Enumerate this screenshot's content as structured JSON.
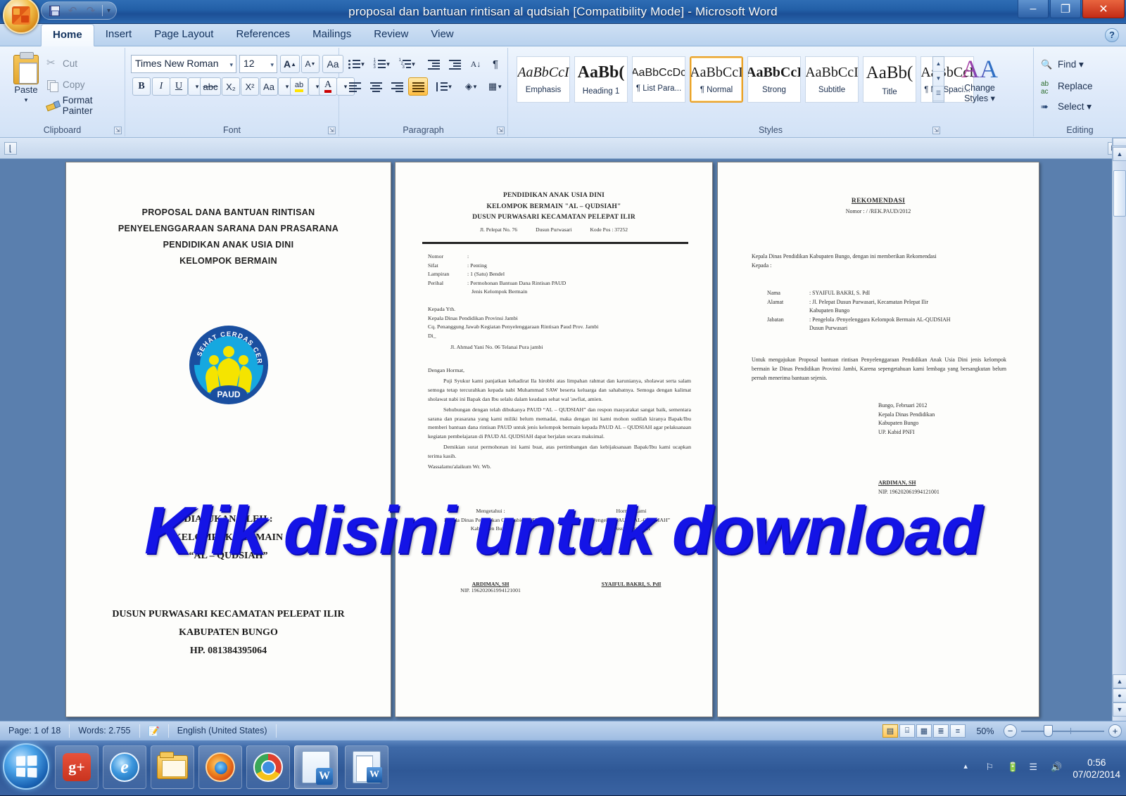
{
  "window": {
    "title": "proposal dan bantuan rintisan al qudsiah [Compatibility Mode] - Microsoft Word",
    "minimize": "–",
    "maximize": "❐",
    "close": "✕"
  },
  "quick_access": {
    "save": "save-icon",
    "undo": "↶",
    "redo": "↷",
    "customize": "▾"
  },
  "tabs": [
    {
      "label": "Home",
      "active": true
    },
    {
      "label": "Insert",
      "active": false
    },
    {
      "label": "Page Layout",
      "active": false
    },
    {
      "label": "References",
      "active": false
    },
    {
      "label": "Mailings",
      "active": false
    },
    {
      "label": "Review",
      "active": false
    },
    {
      "label": "View",
      "active": false
    }
  ],
  "help_button": "?",
  "ribbon": {
    "clipboard": {
      "label": "Clipboard",
      "paste": "Paste",
      "paste_caret": "▾",
      "cut": "Cut",
      "copy": "Copy",
      "format_painter": "Format Painter"
    },
    "font": {
      "label": "Font",
      "font_family_value": "Times New Roman",
      "font_size_value": "12",
      "grow_font": "A",
      "shrink_font": "A",
      "clear_formatting": "Aa",
      "bold": "B",
      "italic": "I",
      "underline": "U",
      "strikethrough": "abc",
      "subscript": "X₂",
      "superscript": "X²",
      "change_case": "Aa",
      "highlight": "ab",
      "font_color": "A",
      "caret": "▾"
    },
    "paragraph": {
      "label": "Paragraph",
      "bullets": "bullet-list-icon",
      "numbering": "numbered-list-icon",
      "multilevel": "multilevel-list-icon",
      "decrease_indent": "decrease-indent-icon",
      "increase_indent": "increase-indent-icon",
      "sort": "sort-icon",
      "show_marks": "¶",
      "align_left": "align-left-icon",
      "align_center": "align-center-icon",
      "align_right": "align-right-icon",
      "justify": "justify-icon",
      "line_spacing": "line-spacing-icon",
      "shading": "shading-icon",
      "borders": "borders-icon"
    },
    "styles": {
      "label": "Styles",
      "items": [
        {
          "preview": "AaBbCcI",
          "name": "Emphasis",
          "selected": false
        },
        {
          "preview": "AaBb(",
          "name": "Heading 1",
          "selected": false
        },
        {
          "preview": "AaBbCcDc",
          "name": "¶ List Para...",
          "selected": false
        },
        {
          "preview": "AaBbCcI",
          "name": "¶ Normal",
          "selected": true
        },
        {
          "preview": "AaBbCcI",
          "name": "Strong",
          "selected": false
        },
        {
          "preview": "AaBbCcI",
          "name": "Subtitle",
          "selected": false
        },
        {
          "preview": "AaBb(",
          "name": "Title",
          "selected": false
        },
        {
          "preview": "AaBbCcI",
          "name": "¶ No Spaci...",
          "selected": false
        }
      ],
      "change_styles_line1": "Change",
      "change_styles_line2": "Styles ▾"
    },
    "editing": {
      "label": "Editing",
      "find": "Find ▾",
      "replace": "Replace",
      "select": "Select ▾"
    }
  },
  "document": {
    "page1": {
      "title_lines": [
        "PROPOSAL DANA BANTUAN RINTISAN",
        "PENYELENGGARAAN  SARANA  DAN  PRASARANA",
        "PENDIDIKAN ANAK USIA DINI",
        "KELOMPOK BERMAIN"
      ],
      "logo": {
        "arc_text": "SEHAT CERDAS CERIA",
        "badge_text": "PAUD"
      },
      "submitted_by": [
        "DIAJUKAN OLEH :",
        "KELOMPOK BERMAIN",
        "“AL – QUDSIAH”"
      ],
      "footer_lines": [
        "DUSUN PURWASARI KECAMATAN PELEPAT ILIR",
        "KABUPATEN BUNGO",
        "HP. 081384395064"
      ]
    },
    "page2": {
      "letterhead": [
        "PENDIDIKAN ANAK USIA DINI",
        "KELOMPOK BERMAIN \"AL – QUDSIAH\"",
        "DUSUN PURWASARI KECAMATAN PELEPAT ILIR"
      ],
      "address": [
        "Jl. Pelepat No. 76",
        "Dusun Purwasari",
        "Kode Pos : 37252"
      ],
      "meta": [
        {
          "key": "Nomor",
          "value": ":"
        },
        {
          "key": "Sifat",
          "value": ": Penting"
        },
        {
          "key": "Lampiran",
          "value": ": 1 (Satu) Bendel"
        },
        {
          "key": "Perihal",
          "value": ": Permohonan Bantuan Dana Rintisan PAUD"
        }
      ],
      "meta_cont": "Jenis Kelompok Bermain",
      "addressee": [
        "Kepada Yth.",
        "Kepala Dinas Pendidikan Provinsi Jambi",
        "Cq. Penanggung Jawab Kegiatan Penyelenggaraan Rintisan Paud Prov. Jambi",
        "Di_"
      ],
      "addressee_indent": "Jl. Ahmad Yani No. 06 Telanai Pura jambi",
      "body": [
        "Dengan Hormat,",
        "Puji Syukur kami panjatkan kehadirat Ila hirobbi atas limpahan rahmat dan karunianya, sholawat serta salam semoga tetap tercurahkan kepada nabi Muhammad SAW beserta keluarga dan sahabatnya. Semoga dengan kalimat sholawat nabi ini Bapak dan Ibu selalu dalam keadaan sehat wal 'awfiat, amien.",
        "Sehubungan dengan telah dibukanya PAUD “AL – QUDSIAH” dan respon masyarakat sangat baik, sementara sarana dan prasarana yang kami miliki belum memadai, maka dengan ini kami mohon sudilah kiranya Bapak/Ibu memberi bantuan dana rintisan PAUD untuk jenis kelompok bermain kepada PAUD AL – QUDSIAH agar pelaksanaan kegiatan pembelajaran di PAUD AL QUDSIAH dapat berjalan secara maksimal.",
        "Demikian surat permohonan ini kami buat, atas pertimbangan dan kebijaksanaan Bapak/Ibu kami ucapkan terima kasih.",
        "Wassalamu'alaikum Wr. Wb."
      ],
      "sign_left": [
        "Mengetahui :",
        "Kepala Dinas Pendidikan Cq. Kabid PNFI",
        "Kabupaten Bungo"
      ],
      "sign_right": [
        "Hormat Kami",
        "Pengelola PAUD “AL-QUDSIAH”",
        "Dusun Purwasari"
      ],
      "name_left": "ARDIMAN, SH",
      "nip_left": "NIP. 196202061994121001",
      "name_right": "SYAIFUL BAKRI, S. PdI"
    },
    "page3": {
      "title": "REKOMENDASI",
      "nomor": "Nomor :          /          /REK.PAUD/2012",
      "intro": [
        "Kepala Dinas Pendidikan Kabupaten Bungo, dengan ini memberikan Rekomendasi",
        "Kepada :"
      ],
      "fields": [
        {
          "key": "Nama",
          "value": ": SYAIFUL BAKRI, S. PdI",
          "cont": ""
        },
        {
          "key": "Alamat",
          "value": ": Jl. Pelepat Dusun Purwasari, Kecamatan Pelepat Ilir",
          "cont": "Kabupaten Bungo"
        },
        {
          "key": "Jabatan",
          "value": ": Pengelola /Penyelenggara Kelompok Bermain AL-QUDSIAH",
          "cont": "Dusun Purwasari"
        }
      ],
      "paragraph": "Untuk mengajukan Proposal bantuan rintisan Penyelenggaraan Pendidikan Anak Usia Dini jenis kelompok bermain ke Dinas Pendidikan Provinsi Jambi, Karena sepengetahuan kami lembaga yang bersangkutan belum pernah menerima bantuan sejenis.",
      "place_block": [
        "Bungo,    Februari 2012",
        "Kepala Dinas Pendidikan",
        "Kabupaten Bungo",
        "UP. Kabid PNFI"
      ],
      "signer_name": "ARDIMAN, SH",
      "signer_nip": "NIP. 196202061994121001"
    }
  },
  "watermark": "Klik disini untuk download",
  "statusbar": {
    "page": "Page: 1 of 18",
    "words": "Words: 2.755",
    "proof_icon": "proofing-errors-icon",
    "language": "English (United States)",
    "views": [
      {
        "name": "print-layout",
        "glyph": "▤",
        "active": true
      },
      {
        "name": "full-screen-reading",
        "glyph": "⌸",
        "active": false
      },
      {
        "name": "web-layout",
        "glyph": "▦",
        "active": false
      },
      {
        "name": "outline",
        "glyph": "≣",
        "active": false
      },
      {
        "name": "draft",
        "glyph": "≡",
        "active": false
      }
    ],
    "zoom": "50%",
    "zoom_out": "−",
    "zoom_in": "+"
  },
  "taskbar": {
    "start": "start-button",
    "items": [
      {
        "name": "google-plus",
        "icon": "gplus-icon",
        "pressed": false
      },
      {
        "name": "internet-explorer",
        "icon": "ie-icon",
        "pressed": false
      },
      {
        "name": "windows-explorer",
        "icon": "folder-icon",
        "pressed": false
      },
      {
        "name": "mozilla-firefox",
        "icon": "firefox-icon",
        "pressed": false
      },
      {
        "name": "google-chrome",
        "icon": "chrome-icon",
        "pressed": false
      },
      {
        "name": "microsoft-word",
        "icon": "word-icon",
        "pressed": true
      },
      {
        "name": "microsoft-word-2",
        "icon": "word-doc-icon",
        "pressed": false
      }
    ],
    "tray": {
      "show_hidden": "▴",
      "action_center": "flag-error-icon",
      "battery": "battery-icon",
      "network": "network-signal-icon",
      "volume": "volume-icon",
      "time": "0:56",
      "date": "07/02/2014"
    }
  }
}
